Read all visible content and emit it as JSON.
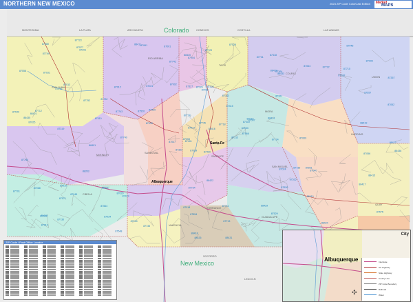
{
  "header": {
    "title": "NORTHERN NEW MEXICO",
    "edition": "2023 ZIP Code ColorCast Edition",
    "logo_line1": "Market",
    "logo_line2": "MAPS"
  },
  "map": {
    "state_labels": {
      "colorado": "Colorado",
      "new_mexico": "New Mexico"
    },
    "county_labels": [
      "MONTEZUMA",
      "LA PLATA",
      "ARCHULETA",
      "CONEJOS",
      "COSTILLA",
      "LAS ANIMAS",
      "SAN JUAN",
      "RIO ARRIBA",
      "TAOS",
      "COLFAX",
      "UNION",
      "McKINLEY",
      "SANDOVAL",
      "MORA",
      "HARDING",
      "SANTA FE",
      "SAN MIGUEL",
      "CIBOLA",
      "VALENCIA",
      "GUADALUPE",
      "QUAY",
      "TORRANCE",
      "CATRON",
      "SOCORRO",
      "LINCOLN",
      "ROOSEVELT",
      "DE BACA"
    ],
    "city_labels": {
      "albuquerque": "Albuquerque",
      "santa_fe": "Santa Fe"
    },
    "zip_labels": [
      "87420",
      "87416",
      "87401",
      "87413",
      "87410",
      "87419",
      "87418",
      "87328",
      "87364",
      "87313",
      "87301",
      "87325",
      "87319",
      "87357",
      "87323",
      "87321",
      "87327",
      "87315",
      "87045",
      "87020",
      "87014",
      "87034",
      "87026",
      "87007",
      "87040",
      "87013",
      "87004",
      "87025",
      "87024",
      "87052",
      "87053",
      "87018",
      "87017",
      "87012",
      "87064",
      "87029",
      "87046",
      "87575",
      "87551",
      "87528",
      "87520",
      "87510",
      "87530",
      "87548",
      "87549",
      "87553",
      "87554",
      "87566",
      "87571",
      "87557",
      "87558",
      "87525",
      "87529",
      "87564",
      "87577",
      "87580",
      "87711",
      "87710",
      "87729",
      "87740",
      "87712",
      "87732",
      "87722",
      "87723",
      "87731",
      "87742",
      "87745",
      "87701",
      "87734",
      "87735",
      "87736",
      "87743",
      "87747",
      "87749",
      "87752",
      "87750",
      "87728",
      "87713",
      "87718",
      "87730",
      "87724",
      "88415",
      "88418",
      "88419",
      "88422",
      "88424",
      "88431",
      "88429",
      "88430",
      "88436",
      "88414",
      "88410",
      "88416",
      "88417",
      "88421",
      "88426",
      "88434",
      "88433",
      "88401",
      "88411",
      "88427",
      "88435",
      "88353",
      "88321",
      "87015",
      "87016",
      "87032",
      "87035",
      "87056",
      "87031",
      "87022",
      "87047",
      "87061",
      "87068",
      "87059",
      "87008",
      "87002",
      "87001",
      "87010",
      "87048",
      "87083",
      "87021",
      "87009"
    ]
  },
  "legend": {
    "title": "ZIP Code / Post Office Locator"
  },
  "inset": {
    "city": "Albuquerque",
    "key": [
      "Interstate",
      "US Highway",
      "State Highway",
      "County Line",
      "ZIP Code Boundary",
      "Railroad",
      "Water"
    ],
    "scale": "City"
  }
}
